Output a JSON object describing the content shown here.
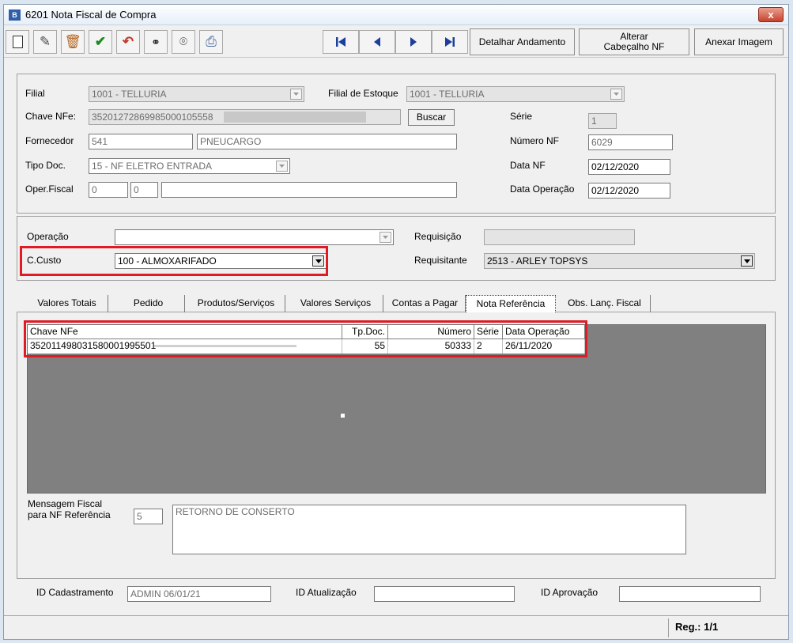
{
  "window": {
    "title": "6201 Nota Fiscal de Compra",
    "icon_text": "B",
    "close_label": "x"
  },
  "toolbar": {
    "detalhar_label": "Detalhar Andamento",
    "alterar_line1": "Alterar",
    "alterar_line2": "Cabeçalho NF",
    "anexar_label": "Anexar Imagem"
  },
  "header": {
    "filial_label": "Filial",
    "filial_value": "1001 - TELLURIA",
    "filial_estoque_label": "Filial de Estoque",
    "filial_estoque_value": "1001 - TELLURIA",
    "chave_label": "Chave NFe:",
    "chave_value": "35201272869985000105558",
    "buscar_label": "Buscar",
    "serie_label": "Série",
    "serie_value": "1",
    "fornecedor_label": "Fornecedor",
    "fornecedor_code": "541",
    "fornecedor_name": "PNEUCARGO",
    "numero_label": "Número NF",
    "numero_value": "6029",
    "tipo_label": "Tipo Doc.",
    "tipo_value": "15 - NF ELETRO ENTRADA",
    "data_nf_label": "Data NF",
    "data_nf_value": "02/12/2020",
    "oper_label": "Oper.Fiscal",
    "oper_a": "0",
    "oper_b": "0",
    "oper_c": "",
    "data_op_label": "Data Operação",
    "data_op_value": "02/12/2020"
  },
  "operacao": {
    "operacao_label": "Operação",
    "operacao_value": "",
    "requisicao_label": "Requisição",
    "requisicao_value": "",
    "ccusto_label": "C.Custo",
    "ccusto_value": "100 - ALMOXARIFADO",
    "requisitante_label": "Requisitante",
    "requisitante_value": "2513 - ARLEY TOPSYS"
  },
  "tabs": [
    {
      "label": "Valores Totais"
    },
    {
      "label": "Pedido"
    },
    {
      "label": "Produtos/Serviços"
    },
    {
      "label": "Valores Serviços"
    },
    {
      "label": "Contas a Pagar"
    },
    {
      "label": "Nota Referência"
    },
    {
      "label": "Obs. Lanç. Fiscal"
    }
  ],
  "grid": {
    "headers": [
      "Chave NFe",
      "Tp.Doc.",
      "Número",
      "Série",
      "Data Operação"
    ],
    "rows": [
      {
        "chave": "352011498031580001995501",
        "tpdoc": "55",
        "numero": "50333",
        "serie": "2",
        "data": "26/11/2020"
      }
    ]
  },
  "mensagem": {
    "label_line1": "Mensagem Fiscal",
    "label_line2": "para NF Referência",
    "code": "5",
    "text": "RETORNO DE CONSERTO"
  },
  "ids": {
    "cad_label": "ID Cadastramento",
    "cad_value": "ADMIN 06/01/21",
    "atu_label": "ID Atualização",
    "atu_value": "",
    "apr_label": "ID Aprovação",
    "apr_value": ""
  },
  "status": {
    "reg": "Reg.: 1/1"
  },
  "colors": {
    "highlight": "#e01b24",
    "grid_bg": "#808080"
  }
}
